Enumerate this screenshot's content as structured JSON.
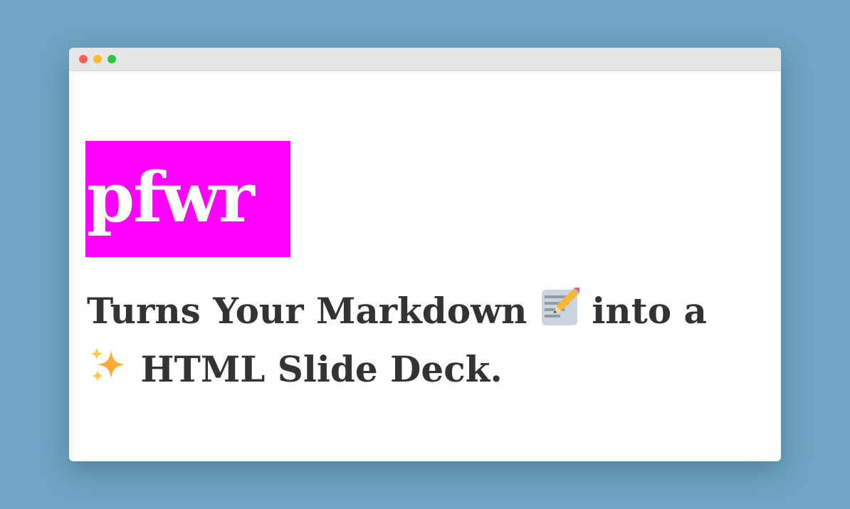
{
  "window": {
    "controls": [
      "close",
      "minimize",
      "zoom"
    ]
  },
  "logo": {
    "text": "pfwr",
    "background": "#ff00ff",
    "color": "#ffffff"
  },
  "tagline": {
    "part1": "Turns Your Markdown",
    "part2": "into a",
    "part3": "HTML Slide Deck.",
    "emoji1": "memo-emoji",
    "emoji2": "sparkles-emoji",
    "color": "#333333"
  },
  "colors": {
    "background": "#6fa6c3",
    "titlebar": "#e6e6e6",
    "close": "#fe5f57",
    "minimize": "#febb2e",
    "zoom": "#28c840"
  }
}
